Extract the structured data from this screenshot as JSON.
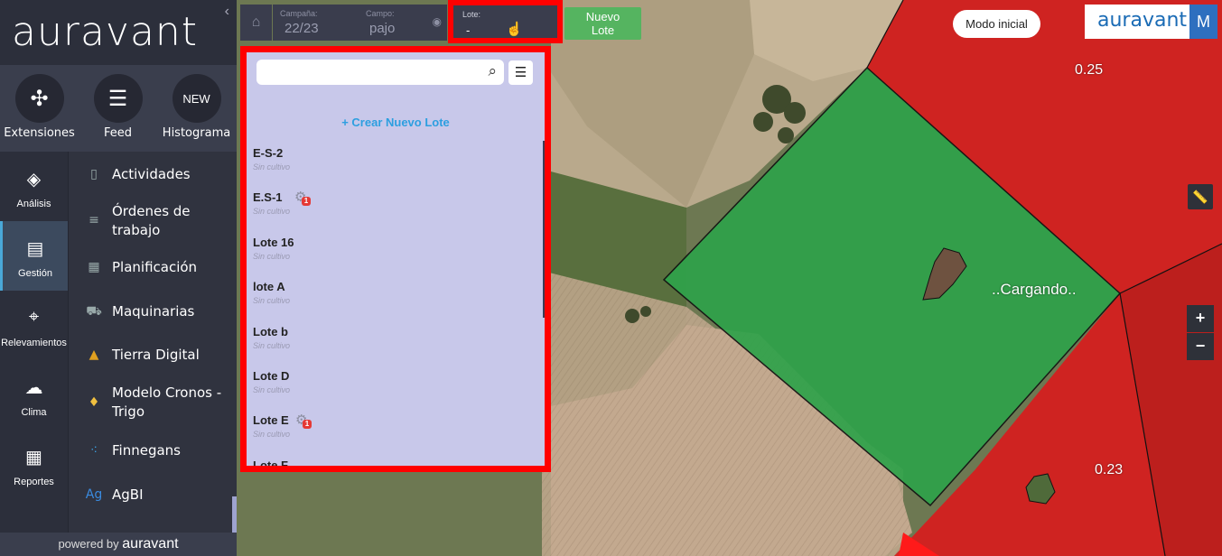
{
  "sidebar": {
    "logo": "auravant",
    "collapse_icon": "chevron-left-icon",
    "quick": [
      {
        "label": "Extensiones",
        "icon": "puzzle-icon",
        "glyph": "✣"
      },
      {
        "label": "Feed",
        "icon": "message-icon",
        "glyph": "☰"
      },
      {
        "label": "Histograma",
        "icon": "new-badge",
        "glyph": "NEW"
      }
    ],
    "nav": [
      {
        "label": "Análisis",
        "icon": "layers-icon",
        "glyph": "◈"
      },
      {
        "label": "Gestión",
        "icon": "clipboard-icon",
        "glyph": "▤"
      },
      {
        "label": "Relevamientos",
        "icon": "pin-icon",
        "glyph": "⌖"
      },
      {
        "label": "Clima",
        "icon": "cloud-icon",
        "glyph": "☁"
      },
      {
        "label": "Reportes",
        "icon": "report-icon",
        "glyph": "▦"
      }
    ],
    "submenu": [
      {
        "label": "Actividades",
        "icon": "activity-icon",
        "glyph": "▯"
      },
      {
        "label": "Órdenes de trabajo",
        "icon": "orders-icon",
        "glyph": "≡"
      },
      {
        "label": "Planificación",
        "icon": "calendar-icon",
        "glyph": "▦"
      },
      {
        "label": "Maquinarias",
        "icon": "tractor-icon",
        "glyph": "⛟"
      },
      {
        "label": "Tierra Digital",
        "icon": "tierra-digital-icon",
        "glyph": "▲"
      },
      {
        "label": "Modelo Cronos - Trigo",
        "icon": "cronos-icon",
        "glyph": "♦"
      },
      {
        "label": "Finnegans",
        "icon": "finnegans-icon",
        "glyph": "⁖"
      },
      {
        "label": "AgBI",
        "icon": "agbi-icon",
        "glyph": "Ag"
      }
    ],
    "powered_text": "powered by",
    "powered_brand": "auravant"
  },
  "topbar": {
    "home_icon": "home-icon",
    "campania_label": "Campaña:",
    "campania_value": "22/23",
    "campo_label": "Campo:",
    "campo_value": "pajo",
    "eye_icon": "eye-icon",
    "lote_label": "Lote:",
    "lote_value": "-",
    "nuevo_lote": "Nuevo Lote",
    "modo_inicial": "Modo inicial",
    "brand": "auravant",
    "brand_initial": "M"
  },
  "panel": {
    "search_placeholder": "",
    "crear": "+  Crear Nuevo Lote",
    "lotes": [
      {
        "name": "E-S-2",
        "sub": "Sin cultivo",
        "badge": ""
      },
      {
        "name": "E.S-1",
        "sub": "Sin cultivo",
        "badge": "1"
      },
      {
        "name": "Lote 16",
        "sub": "Sin cultivo",
        "badge": ""
      },
      {
        "name": "lote A",
        "sub": "Sin cultivo",
        "badge": ""
      },
      {
        "name": "Lote b",
        "sub": "Sin cultivo",
        "badge": ""
      },
      {
        "name": "Lote D",
        "sub": "Sin cultivo",
        "badge": ""
      },
      {
        "name": "Lote E",
        "sub": "Sin cultivo",
        "badge": "1"
      },
      {
        "name": "Lote F",
        "sub": "",
        "badge": ""
      }
    ]
  },
  "map": {
    "labels": {
      "top_value": "0.25",
      "loading": "..Cargando..",
      "bottom_value": "0.23"
    },
    "zoom_in": "+",
    "zoom_out": "−",
    "ruler_icon": "ruler-icon",
    "colors": {
      "green_field": "#2fa24a",
      "red_field": "#d61d1d",
      "panel_bg": "#c8c8ea",
      "highlight": "#ff0000"
    }
  }
}
